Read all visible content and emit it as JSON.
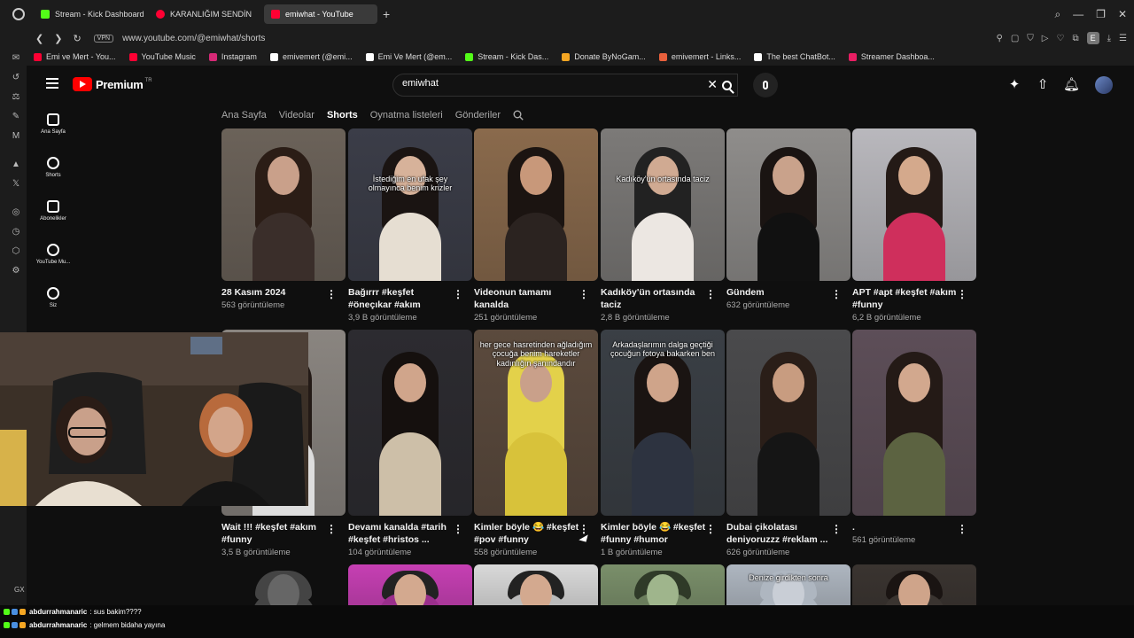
{
  "browser": {
    "tabs": [
      {
        "label": "Stream - Kick Dashboard",
        "color": "#53fc18"
      },
      {
        "label": "KARANLIĞIM SENDİN",
        "color": "#ff0033"
      },
      {
        "label": "emiwhat - YouTube",
        "color": "#ff0033"
      }
    ],
    "new_tab": "+",
    "vpn": "VPN",
    "url": "www.youtube.com/@emiwhat/shorts",
    "bookmarks": [
      {
        "label": "Emi ve Mert - You...",
        "color": "#ff0033"
      },
      {
        "label": "YouTube Music",
        "color": "#ff0033"
      },
      {
        "label": "Instagram",
        "color": "#d62976"
      },
      {
        "label": "emivemert (@emi...",
        "color": "#ffffff"
      },
      {
        "label": "Emi Ve Mert (@em...",
        "color": "#ffffff"
      },
      {
        "label": "Stream - Kick Das...",
        "color": "#53fc18"
      },
      {
        "label": "Donate ByNoGam...",
        "color": "#f5a623"
      },
      {
        "label": "emivemert - Links...",
        "color": "#e8603c"
      },
      {
        "label": "The best ChatBot...",
        "color": "#ffffff"
      },
      {
        "label": "Streamer Dashboa...",
        "color": "#e91e63"
      }
    ],
    "profile_letter": "E"
  },
  "youtube": {
    "brand": "Premium",
    "brand_sup": "TR",
    "search_value": "emiwhat",
    "guide": [
      {
        "label": "Ana Sayfa"
      },
      {
        "label": "Shorts"
      },
      {
        "label": "Abonelikler"
      },
      {
        "label": "YouTube Mu..."
      },
      {
        "label": "Siz"
      }
    ],
    "channel_tabs": [
      "Ana Sayfa",
      "Videolar",
      "Shorts",
      "Oynatma listeleri",
      "Gönderiler"
    ],
    "active_tab": "Shorts",
    "shorts": [
      {
        "title": "28 Kasım 2024",
        "views": "563 görüntüleme",
        "caption": "",
        "bg": "#6b6259",
        "hair": "#2b1d16",
        "skin": "#c9a08a",
        "top": "#3a2e2a"
      },
      {
        "title": "Bağırrr #keşfet #öneçıkar #akım",
        "views": "3,9 B görüntüleme",
        "caption": "İstediğim en ufak şey olmayınca benim krizler",
        "bg": "#3b3d48",
        "hair": "#1a1412",
        "skin": "#d7b29a",
        "top": "#e6ded2"
      },
      {
        "title": "Videonun tamamı kanalda",
        "views": "251 görüntüleme",
        "caption": "",
        "bg": "#8a6a4c",
        "hair": "#1b1411",
        "skin": "#c8987a",
        "top": "#2b2320"
      },
      {
        "title": "Kadıköy'ün ortasında taciz",
        "views": "2,8 B görüntüleme",
        "caption": "Kadıköy'ün ortasında taciz",
        "bg": "#7c7a78",
        "hair": "#222",
        "skin": "#d0aa92",
        "top": "#ece7e2"
      },
      {
        "title": "Gündem",
        "views": "632 görüntüleme",
        "caption": "",
        "bg": "#8f8d8b",
        "hair": "#1a1412",
        "skin": "#c9a28b",
        "top": "#111"
      },
      {
        "title": "APT #apt #keşfet #akım #funny",
        "views": "6,2 B görüntüleme",
        "caption": "",
        "bg": "#b9b8bd",
        "hair": "#241a16",
        "skin": "#d4a98c",
        "top": "#cf2f5c"
      },
      {
        "title": "Wait !!! #keşfet #akım #funny",
        "views": "3,5 B görüntüleme",
        "caption": "",
        "bg": "#8a8580",
        "hair": "#231a16",
        "skin": "#c49a7e",
        "top": "#ddd"
      },
      {
        "title": "Devamı kanalda #tarih #keşfet #hristos ...",
        "views": "104 görüntüleme",
        "caption": "",
        "bg": "#2c2b30",
        "hair": "#15100e",
        "skin": "#d0a58b",
        "top": "#cdbfa8"
      },
      {
        "title": "Kimler böyle 😂 #keşfet #pov #funny",
        "views": "558 görüntüleme",
        "caption": "her gece hasretinden ağladığım çocuğa benim hareketler kadınlığın şanındandır",
        "bg": "#5b4a3d",
        "hair": "#e3d14a",
        "skin": "#c9a08a",
        "top": "#d8c23a"
      },
      {
        "title": "Kimler böyle 😂 #keşfet #funny #humor",
        "views": "1 B görüntüleme",
        "caption": "Arkadaşlarımın dalga geçtiği çocuğun fotoya bakarken ben",
        "bg": "#3a3f45",
        "hair": "#1a1412",
        "skin": "#cfa48a",
        "top": "#2d3340"
      },
      {
        "title": "Dubai çikolatası deniyoruzzz #reklam ...",
        "views": "626 görüntüleme",
        "caption": "",
        "bg": "#4a4a4c",
        "hair": "#2a1e18",
        "skin": "#c89c80",
        "top": "#151515"
      },
      {
        "title": ".",
        "views": "561 görüntüleme",
        "caption": "",
        "bg": "#5d4e58",
        "hair": "#241a16",
        "skin": "#d2a88e",
        "top": "#5c6341"
      },
      {
        "title": "",
        "views": "",
        "caption": "",
        "bg": "#444",
        "hair": "#444",
        "skin": "#666",
        "top": "#444"
      },
      {
        "title": "",
        "views": "",
        "caption": "",
        "bg": "#c63fb3",
        "hair": "#222",
        "skin": "#d3a98f",
        "top": "#9a2f8c"
      },
      {
        "title": "",
        "views": "",
        "caption": "",
        "bg": "#d9d9d9",
        "hair": "#222",
        "skin": "#d3a98f",
        "top": "#bbb"
      },
      {
        "title": "",
        "views": "",
        "caption": "",
        "bg": "#7a8f6a",
        "hair": "#2f3a28",
        "skin": "#9fb58c",
        "top": "#6a7d5c"
      },
      {
        "title": "",
        "views": "",
        "caption": "Denize girdikten sonra",
        "bg": "#aeb6c0",
        "hair": "#aeb6c0",
        "skin": "#c9ced6",
        "top": "#aeb6c0"
      },
      {
        "title": "",
        "views": "",
        "caption": "",
        "bg": "#3a3430",
        "hair": "#1a1412",
        "skin": "#cfa48a",
        "top": "#3a3430"
      }
    ]
  },
  "chat": [
    {
      "user": "abdurrahmanaric",
      "msg": ": sus bakim????"
    },
    {
      "user": "abdurrahmanaric",
      "msg": ": gelmem bidaha yayına"
    }
  ],
  "gx_label": "GX"
}
